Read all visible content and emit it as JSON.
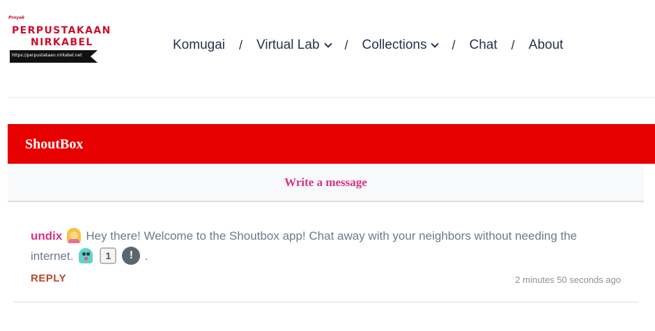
{
  "logo": {
    "prefix": "Proyek",
    "line1": "PERPUSTAKAAN",
    "line2": "NIRKABEL",
    "url": "https://perpustakaan.nirkabel.net"
  },
  "nav": {
    "items": [
      {
        "label": "Komugai",
        "has_dropdown": false
      },
      {
        "label": "Virtual Lab",
        "has_dropdown": true
      },
      {
        "label": "Collections",
        "has_dropdown": true
      },
      {
        "label": "Chat",
        "has_dropdown": false
      },
      {
        "label": "About",
        "has_dropdown": false
      }
    ],
    "separator": "/"
  },
  "shoutbox": {
    "title": "ShoutBox",
    "write_label": "Write a message",
    "messages": [
      {
        "user": "undix",
        "text_part1": "Hey there! Welcome to the Shoutbox app! Chat away with your neighbors without needing the internet.",
        "keycap": "1",
        "exclamation": "!",
        "end": ".",
        "reply_label": "REPLY",
        "timestamp": "2 minutes 50 seconds ago",
        "icons": [
          "woman-tipping-hand-icon",
          "ghost-icon",
          "keycap-one-icon",
          "exclamation-icon"
        ]
      }
    ]
  },
  "colors": {
    "brand_red": "#e60000",
    "username_pink": "#d63384",
    "reply_orange": "#b5472b",
    "nav_text": "#25324a"
  }
}
